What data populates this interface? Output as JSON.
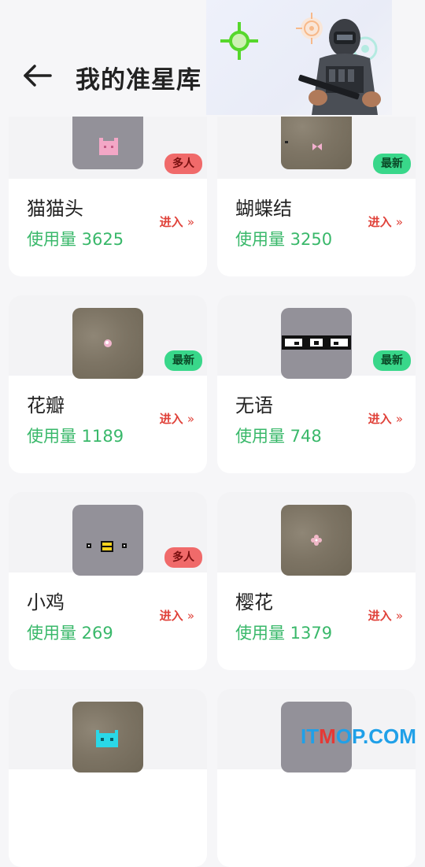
{
  "header": {
    "title": "我的准星库"
  },
  "enter_label": "进入",
  "usage_prefix": "使用量",
  "cards": [
    {
      "name": "猫猫头",
      "usage": "使用量 3625",
      "badge": "多人",
      "enter": "进入"
    },
    {
      "name": "蝴蝶结",
      "usage": "使用量 3250",
      "badge": "最新",
      "enter": "进入"
    },
    {
      "name": "花瓣",
      "usage": "使用量 1189",
      "badge": "最新",
      "enter": "进入"
    },
    {
      "name": "无语",
      "usage": "使用量 748",
      "badge": "最新",
      "enter": "进入"
    },
    {
      "name": "小鸡",
      "usage": "使用量 269",
      "badge": "多人",
      "enter": "进入"
    },
    {
      "name": "樱花",
      "usage": "使用量 1379",
      "enter": "进入"
    }
  ],
  "watermark": {
    "prefix": "IT",
    "highlight": "M",
    "suffix": "OP.COM"
  },
  "colors": {
    "accent_green": "#39b86a",
    "badge_multi": "#f06a6a",
    "badge_new": "#39d78a",
    "enter_red": "#e0423a"
  }
}
